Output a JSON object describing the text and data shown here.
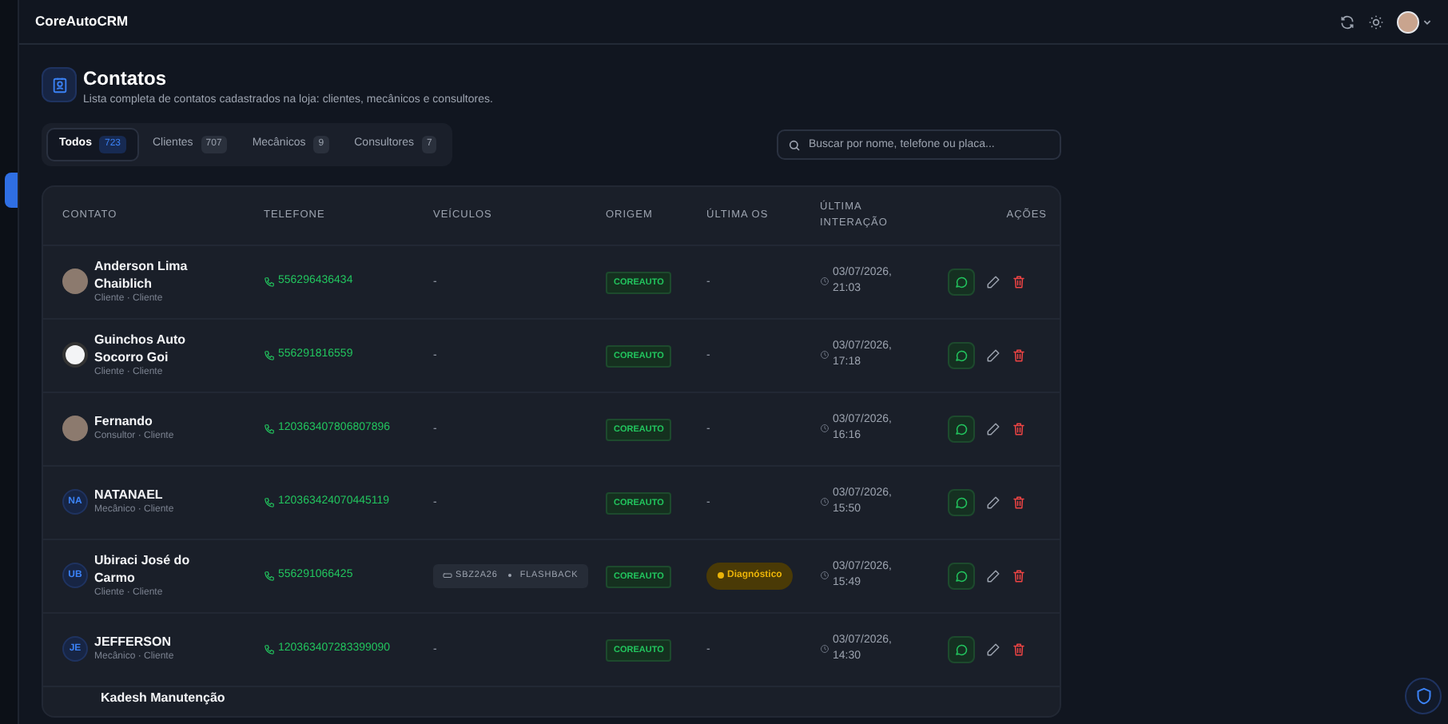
{
  "topbar": {
    "brand": "CoreAutoCRM"
  },
  "header": {
    "title": "Contatos",
    "subtitle": "Lista completa de contatos cadastrados na loja: clientes, mecânicos e consultores."
  },
  "tabs": [
    {
      "label": "Todos",
      "count": "723",
      "selected": true
    },
    {
      "label": "Clientes",
      "count": "707",
      "selected": false
    },
    {
      "label": "Mecânicos",
      "count": "9",
      "selected": false
    },
    {
      "label": "Consultores",
      "count": "7",
      "selected": false
    }
  ],
  "search": {
    "placeholder": "Buscar por nome, telefone ou placa..."
  },
  "table": {
    "columns": [
      "CONTATO",
      "TELEFONE",
      "VEÍCULOS",
      "ORIGEM",
      "ÚLTIMA OS",
      "ÚLTIMA INTERAÇÃO",
      "AÇÕES"
    ],
    "rows": [
      {
        "kind": "full",
        "avatar": {
          "kind": "photo"
        },
        "name": "Anderson Lima Chaiblich",
        "role": "Cliente · Cliente",
        "phone": "556296436434",
        "vehicle": {
          "kind": "empty",
          "text": "-"
        },
        "origin": "COREAUTO",
        "last_os": {
          "kind": "empty",
          "text": "-"
        },
        "interaction": "03/07/2026, 21:03"
      },
      {
        "kind": "full",
        "avatar": {
          "kind": "logo"
        },
        "name": "Guinchos Auto Socorro Goi",
        "role": "Cliente · Cliente",
        "phone": "556291816559",
        "vehicle": {
          "kind": "empty",
          "text": "-"
        },
        "origin": "COREAUTO",
        "last_os": {
          "kind": "empty",
          "text": "-"
        },
        "interaction": "03/07/2026, 17:18"
      },
      {
        "kind": "full",
        "avatar": {
          "kind": "photo"
        },
        "name": "Fernando",
        "role": "Consultor · Cliente",
        "phone": "120363407806807896",
        "vehicle": {
          "kind": "empty",
          "text": "-"
        },
        "origin": "COREAUTO",
        "last_os": {
          "kind": "empty",
          "text": "-"
        },
        "interaction": "03/07/2026, 16:16"
      },
      {
        "kind": "full",
        "avatar": {
          "kind": "initials",
          "text": "NA"
        },
        "name": "NATANAEL",
        "role": "Mecânico · Cliente",
        "phone": "120363424070445119",
        "vehicle": {
          "kind": "empty",
          "text": "-"
        },
        "origin": "COREAUTO",
        "last_os": {
          "kind": "empty",
          "text": "-"
        },
        "interaction": "03/07/2026, 15:50"
      },
      {
        "kind": "full",
        "avatar": {
          "kind": "initials",
          "text": "UB"
        },
        "name": "Ubiraci José do Carmo",
        "role": "Cliente · Cliente",
        "phone": "556291066425",
        "vehicle": {
          "kind": "chip",
          "plate": "SBZ2A26",
          "model": "FLASHBACK"
        },
        "origin": "COREAUTO",
        "last_os": {
          "kind": "status",
          "text": "Diagnóstico"
        },
        "interaction": "03/07/2026, 15:49"
      },
      {
        "kind": "full",
        "avatar": {
          "kind": "initials",
          "text": "JE"
        },
        "name": "JEFFERSON",
        "role": "Mecânico · Cliente",
        "phone": "120363407283399090",
        "vehicle": {
          "kind": "empty",
          "text": "-"
        },
        "origin": "COREAUTO",
        "last_os": {
          "kind": "empty",
          "text": "-"
        },
        "interaction": "03/07/2026, 14:30"
      },
      {
        "kind": "partial",
        "name": "Kadesh Manutenção"
      }
    ]
  }
}
